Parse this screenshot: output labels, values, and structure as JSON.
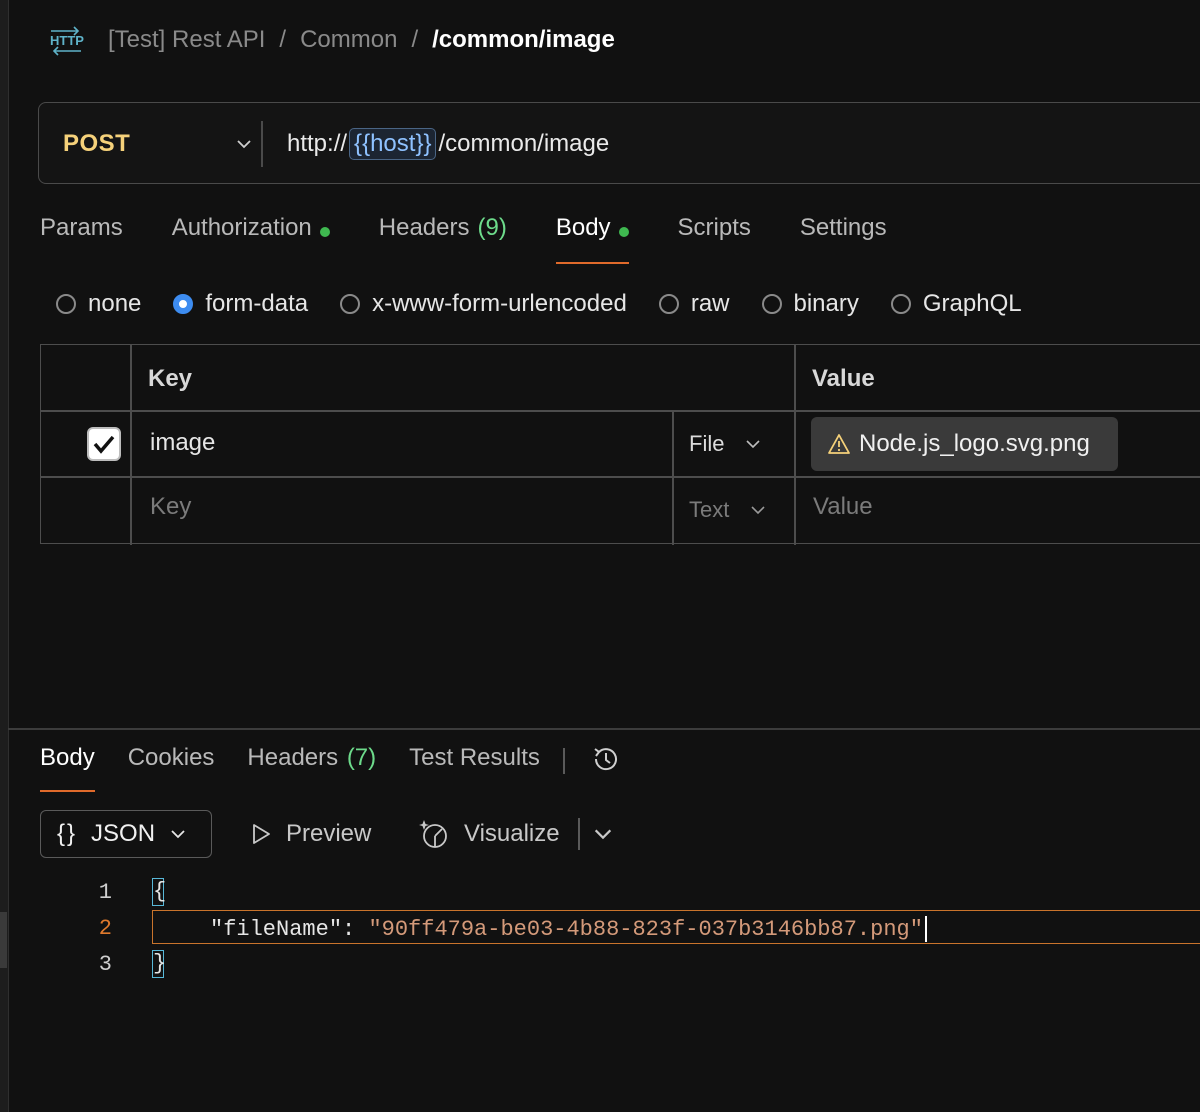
{
  "breadcrumb": {
    "items": [
      "[Test] Rest API",
      "Common"
    ],
    "current": "/common/image",
    "separator": "/"
  },
  "request": {
    "method": "POST",
    "url_prefix": "http://",
    "url_variable": "{{host}}",
    "url_suffix": "/common/image"
  },
  "request_tabs": [
    {
      "label": "Params"
    },
    {
      "label": "Authorization"
    },
    {
      "label": "Headers",
      "count": "(9)"
    },
    {
      "label": "Body"
    },
    {
      "label": "Scripts"
    },
    {
      "label": "Settings"
    }
  ],
  "body_types": [
    "none",
    "form-data",
    "x-www-form-urlencoded",
    "raw",
    "binary",
    "GraphQL"
  ],
  "body_type_selected": "form-data",
  "form_table": {
    "headers": {
      "key": "Key",
      "value": "Value"
    },
    "rows": [
      {
        "checked": true,
        "key": "image",
        "type": "File",
        "value": "Node.js_logo.svg.png"
      }
    ],
    "new_row": {
      "key_placeholder": "Key",
      "type": "Text",
      "value_placeholder": "Value"
    }
  },
  "response_tabs": [
    {
      "label": "Body"
    },
    {
      "label": "Cookies"
    },
    {
      "label": "Headers",
      "count": "(7)"
    },
    {
      "label": "Test Results"
    }
  ],
  "response_toolbar": {
    "format_braces": "{}",
    "format": "JSON",
    "preview": "Preview",
    "visualize": "Visualize"
  },
  "response_body": {
    "line_numbers": [
      "1",
      "2",
      "3"
    ],
    "open_brace": "{",
    "close_brace": "}",
    "key": "\"fileName\"",
    "colon": ": ",
    "value": "\"90ff479a-be03-4b88-823f-037b3146bb87.png\""
  },
  "colors": {
    "background": "#111111",
    "method": "#f5d17a",
    "active_tab_underline": "#e06a2b",
    "status_dot": "#3fb950",
    "count": "#6ddb8b",
    "radio_selected": "#3d8cf0",
    "json_string": "#d49a7a"
  }
}
